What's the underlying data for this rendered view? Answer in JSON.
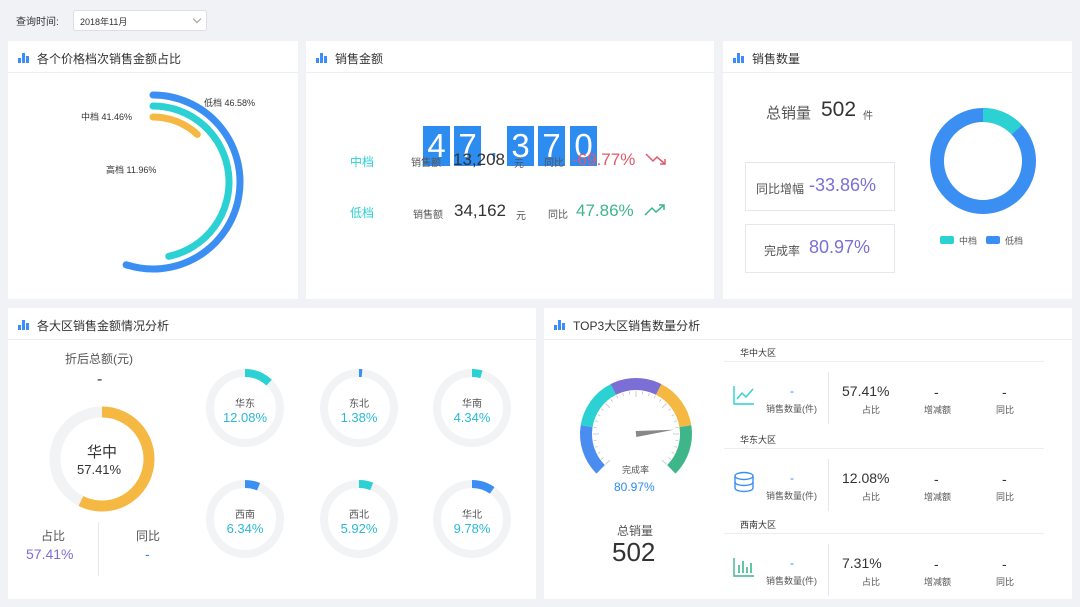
{
  "query": {
    "label": "查询时间:",
    "value": "2018年11月"
  },
  "price_panel": {
    "title": "各个价格档次销售金额占比",
    "labels": {
      "low": "低档 46.58%",
      "mid": "中档 41.46%",
      "high": "高档 11.96%"
    },
    "colors": {
      "low": "#3b8ff2",
      "mid": "#2bd1d3",
      "high": "#f5b943"
    }
  },
  "amount_panel": {
    "title": "销售金额",
    "digits": [
      "4",
      "7",
      ",",
      "3",
      "7",
      "0"
    ],
    "rows": [
      {
        "tier": "中档",
        "amount_label": "销售额",
        "amount": "13,208",
        "unit": "元",
        "yoy_label": "同比",
        "yoy": "-69.77%",
        "trend": "down"
      },
      {
        "tier": "低档",
        "amount_label": "销售额",
        "amount": "34,162",
        "unit": "元",
        "yoy_label": "同比",
        "yoy": "47.86%",
        "trend": "up"
      }
    ]
  },
  "qty_panel": {
    "title": "销售数量",
    "total_label": "总销量",
    "total": "502",
    "total_unit": "件",
    "yoy_label": "同比增幅",
    "yoy": "-33.86%",
    "rate_label": "完成率",
    "rate": "80.97%",
    "legend": [
      "中档",
      "低档"
    ],
    "donut": {
      "mid": 0.1316,
      "low": 0.8684
    }
  },
  "region_panel": {
    "title": "各大区销售金额情况分析",
    "discount_label": "折后总额(元)",
    "discount_value": "-",
    "main": {
      "name": "华中",
      "value": "57.41%",
      "fraction": 0.5741
    },
    "share_label": "占比",
    "share_value": "57.41%",
    "yoy_label": "同比",
    "yoy_value": "-",
    "small": [
      {
        "name": "华东",
        "value": "12.08%",
        "fraction": 0.1208
      },
      {
        "name": "东北",
        "value": "1.38%",
        "fraction": 0.0138
      },
      {
        "name": "华南",
        "value": "4.34%",
        "fraction": 0.0434
      },
      {
        "name": "西南",
        "value": "6.34%",
        "fraction": 0.0634
      },
      {
        "name": "西北",
        "value": "5.92%",
        "fraction": 0.0592
      },
      {
        "name": "华北",
        "value": "9.78%",
        "fraction": 0.0978
      }
    ]
  },
  "top3_panel": {
    "title": "TOP3大区销售数量分析",
    "gauge_label": "完成率",
    "gauge_value": "80.97%",
    "gauge_fraction": 0.8097,
    "total_label": "总销量",
    "total": "502",
    "regions": [
      {
        "name": "华中大区",
        "icon": "line-chart-icon",
        "qty": "-",
        "qty_label": "销售数量(件)",
        "share": "57.41%",
        "share_label": "占比",
        "inc": "-",
        "inc_label": "增减额",
        "yoy": "-",
        "yoy_label": "同比"
      },
      {
        "name": "华东大区",
        "icon": "database-icon",
        "qty": "-",
        "qty_label": "销售数量(件)",
        "share": "12.08%",
        "share_label": "占比",
        "inc": "-",
        "inc_label": "增减额",
        "yoy": "-",
        "yoy_label": "同比"
      },
      {
        "name": "西南大区",
        "icon": "bar-chart-icon",
        "qty": "-",
        "qty_label": "销售数量(件)",
        "share": "7.31%",
        "share_label": "占比",
        "inc": "-",
        "inc_label": "增减额",
        "yoy": "-",
        "yoy_label": "同比"
      }
    ]
  },
  "colors": {
    "accent": "#2d8cf0",
    "cyan": "#2bd1d3",
    "purple": "#7b6fd6",
    "red": "#e05a6d",
    "green": "#3fb68a",
    "orange": "#f5b943"
  }
}
